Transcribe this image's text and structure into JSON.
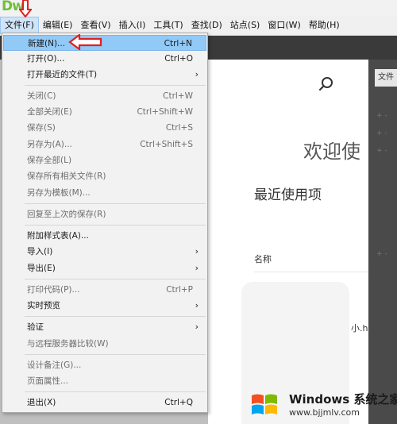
{
  "app": {
    "logo_text": "Dw"
  },
  "menubar": {
    "items": [
      {
        "label": "文件(F)"
      },
      {
        "label": "编辑(E)"
      },
      {
        "label": "查看(V)"
      },
      {
        "label": "插入(I)"
      },
      {
        "label": "工具(T)"
      },
      {
        "label": "查找(D)"
      },
      {
        "label": "站点(S)"
      },
      {
        "label": "窗口(W)"
      },
      {
        "label": "帮助(H)"
      }
    ]
  },
  "file_menu": {
    "items": [
      {
        "label": "新建(N)...",
        "shortcut": "Ctrl+N",
        "highlighted": true
      },
      {
        "label": "打开(O)...",
        "shortcut": "Ctrl+O"
      },
      {
        "label": "打开最近的文件(T)",
        "submenu": true
      },
      {
        "label": "关闭(C)",
        "shortcut": "Ctrl+W",
        "disabled": true
      },
      {
        "label": "全部关闭(E)",
        "shortcut": "Ctrl+Shift+W",
        "disabled": true
      },
      {
        "label": "保存(S)",
        "shortcut": "Ctrl+S",
        "disabled": true
      },
      {
        "label": "另存为(A)...",
        "shortcut": "Ctrl+Shift+S",
        "disabled": true
      },
      {
        "label": "保存全部(L)",
        "disabled": true
      },
      {
        "label": "保存所有相关文件(R)",
        "disabled": true
      },
      {
        "label": "另存为模板(M)...",
        "disabled": true
      },
      {
        "label": "回复至上次的保存(R)",
        "disabled": true
      },
      {
        "label": "附加样式表(A)..."
      },
      {
        "label": "导入(I)",
        "submenu": true
      },
      {
        "label": "导出(E)",
        "submenu": true
      },
      {
        "label": "打印代码(P)...",
        "shortcut": "Ctrl+P",
        "disabled": true
      },
      {
        "label": "实时预览",
        "submenu": true
      },
      {
        "label": "验证",
        "submenu": true
      },
      {
        "label": "与远程服务器比较(W)",
        "disabled": true
      },
      {
        "label": "设计备注(G)...",
        "disabled": true
      },
      {
        "label": "页面属性...",
        "disabled": true
      },
      {
        "label": "退出(X)",
        "shortcut": "Ctrl+Q"
      }
    ],
    "submenu_arrow": "›"
  },
  "welcome": {
    "greeting": "欢迎使",
    "recent_title": "最近使用项",
    "name_header": "名称",
    "recent_file": "小.h"
  },
  "right_panel": {
    "tab_label": "文件"
  },
  "watermark": {
    "brand": "Windows 系统之家",
    "url": "www.bjjmlv.com"
  },
  "colors": {
    "highlight": "#91c9f7",
    "arrow_red": "#e02020",
    "logo_green": "#6fbf3c"
  }
}
